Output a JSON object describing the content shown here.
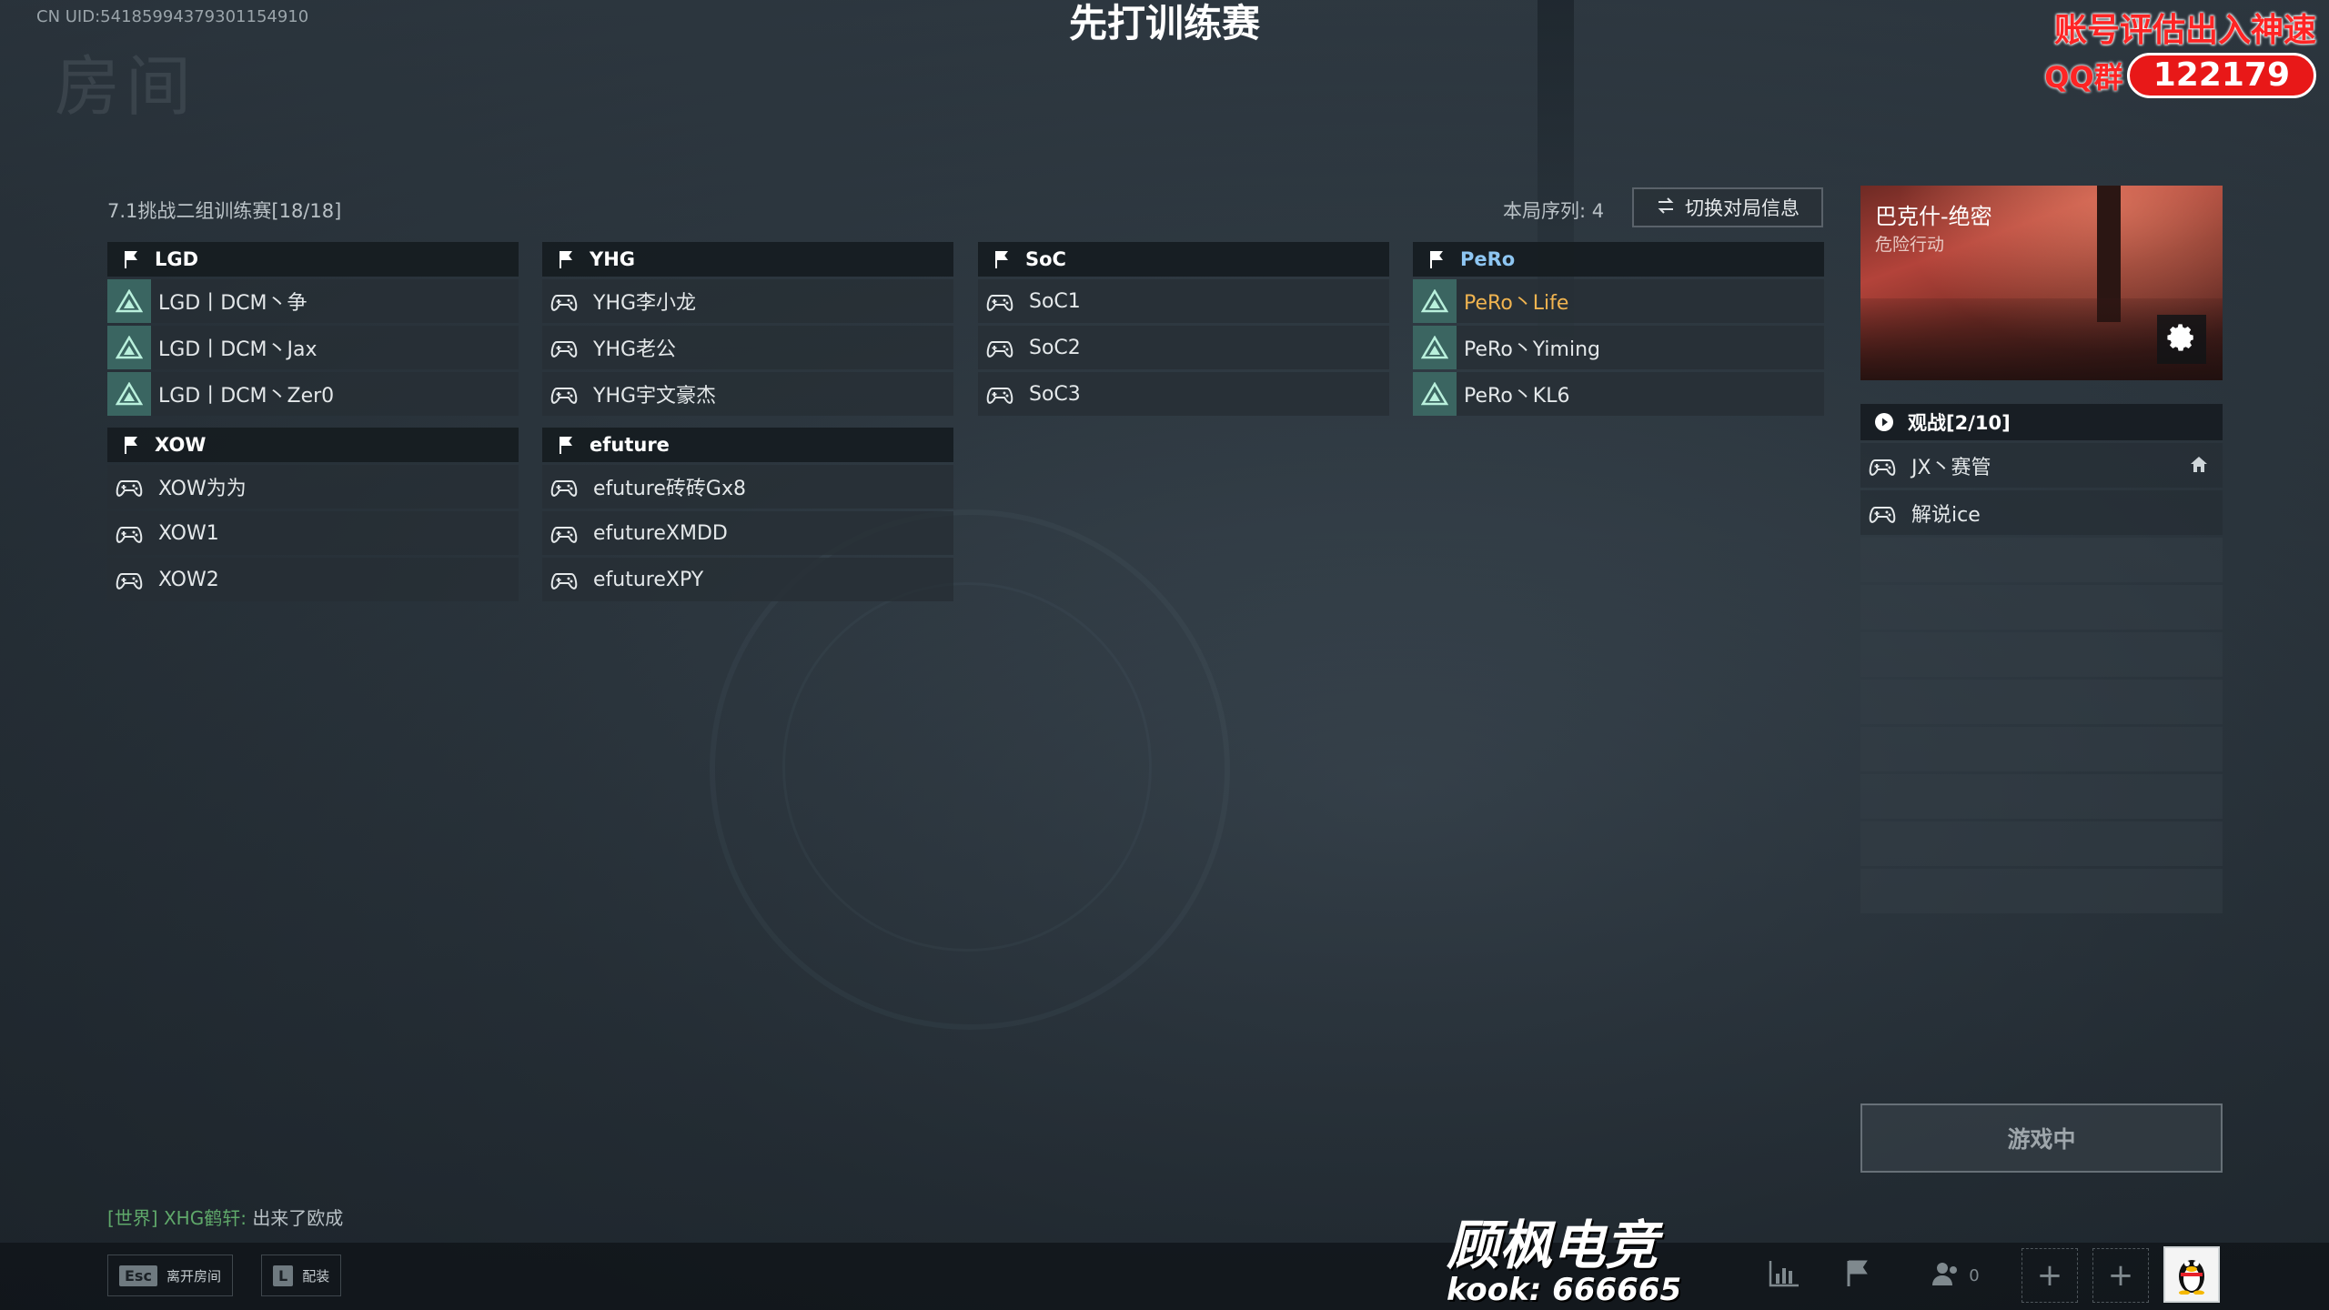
{
  "header": {
    "uid": "CN UID:54185994379301154910",
    "title": "先打训练赛"
  },
  "promo": {
    "line1": "账号评估出入神速",
    "qq_label": "QQ群",
    "qq_number": "122179"
  },
  "room": {
    "title": "7.1挑战二组训练赛[18/18]",
    "round_label": "本局序列: 4",
    "switch_button": "切换对局信息"
  },
  "teams": [
    {
      "name": "LGD",
      "players": [
        "LGD丨DCM丶争",
        "LGD丨DCM丶Jax",
        "LGD丨DCM丶Zer0"
      ]
    },
    {
      "name": "YHG",
      "players": [
        "YHG李小龙",
        "YHG老公",
        "YHG宇文豪杰"
      ]
    },
    {
      "name": "SoC",
      "players": [
        "SoC1",
        "SoC2",
        "SoC3"
      ]
    },
    {
      "name": "PeRo",
      "players": [
        "PeRo丶Life",
        "PeRo丶Yiming",
        "PeRo丶KL6"
      ]
    },
    {
      "name": "XOW",
      "players": [
        "XOW为为",
        "XOW1",
        "XOW2"
      ]
    },
    {
      "name": "efuture",
      "players": [
        "efuture砖砖Gx8",
        "efutureXMDD",
        "efutureXPY"
      ]
    }
  ],
  "map": {
    "name": "巴克什-绝密",
    "mode": "危险行动"
  },
  "spectators": {
    "header": "观战[2/10]",
    "list": [
      "JX丶赛管",
      "解说ice"
    ]
  },
  "status_button": "游戏中",
  "chat": {
    "channel": "[世界]",
    "sender": "XHG鹤轩:",
    "message": "出来了欧成"
  },
  "bottom": {
    "esc_key": "Esc",
    "esc_label": "离开房间",
    "l_key": "L",
    "l_label": "配装",
    "friends_count": "0"
  },
  "brand": {
    "name": "顾枫电竞",
    "kook": "kook: 666665"
  },
  "colors": {
    "accent_triangle_bg": "#3e6e68",
    "pero_header": "#8ec6f2",
    "self_highlight": "#f0b450",
    "chat_green": "#5fa86a",
    "promo_red": "#ff2424"
  }
}
